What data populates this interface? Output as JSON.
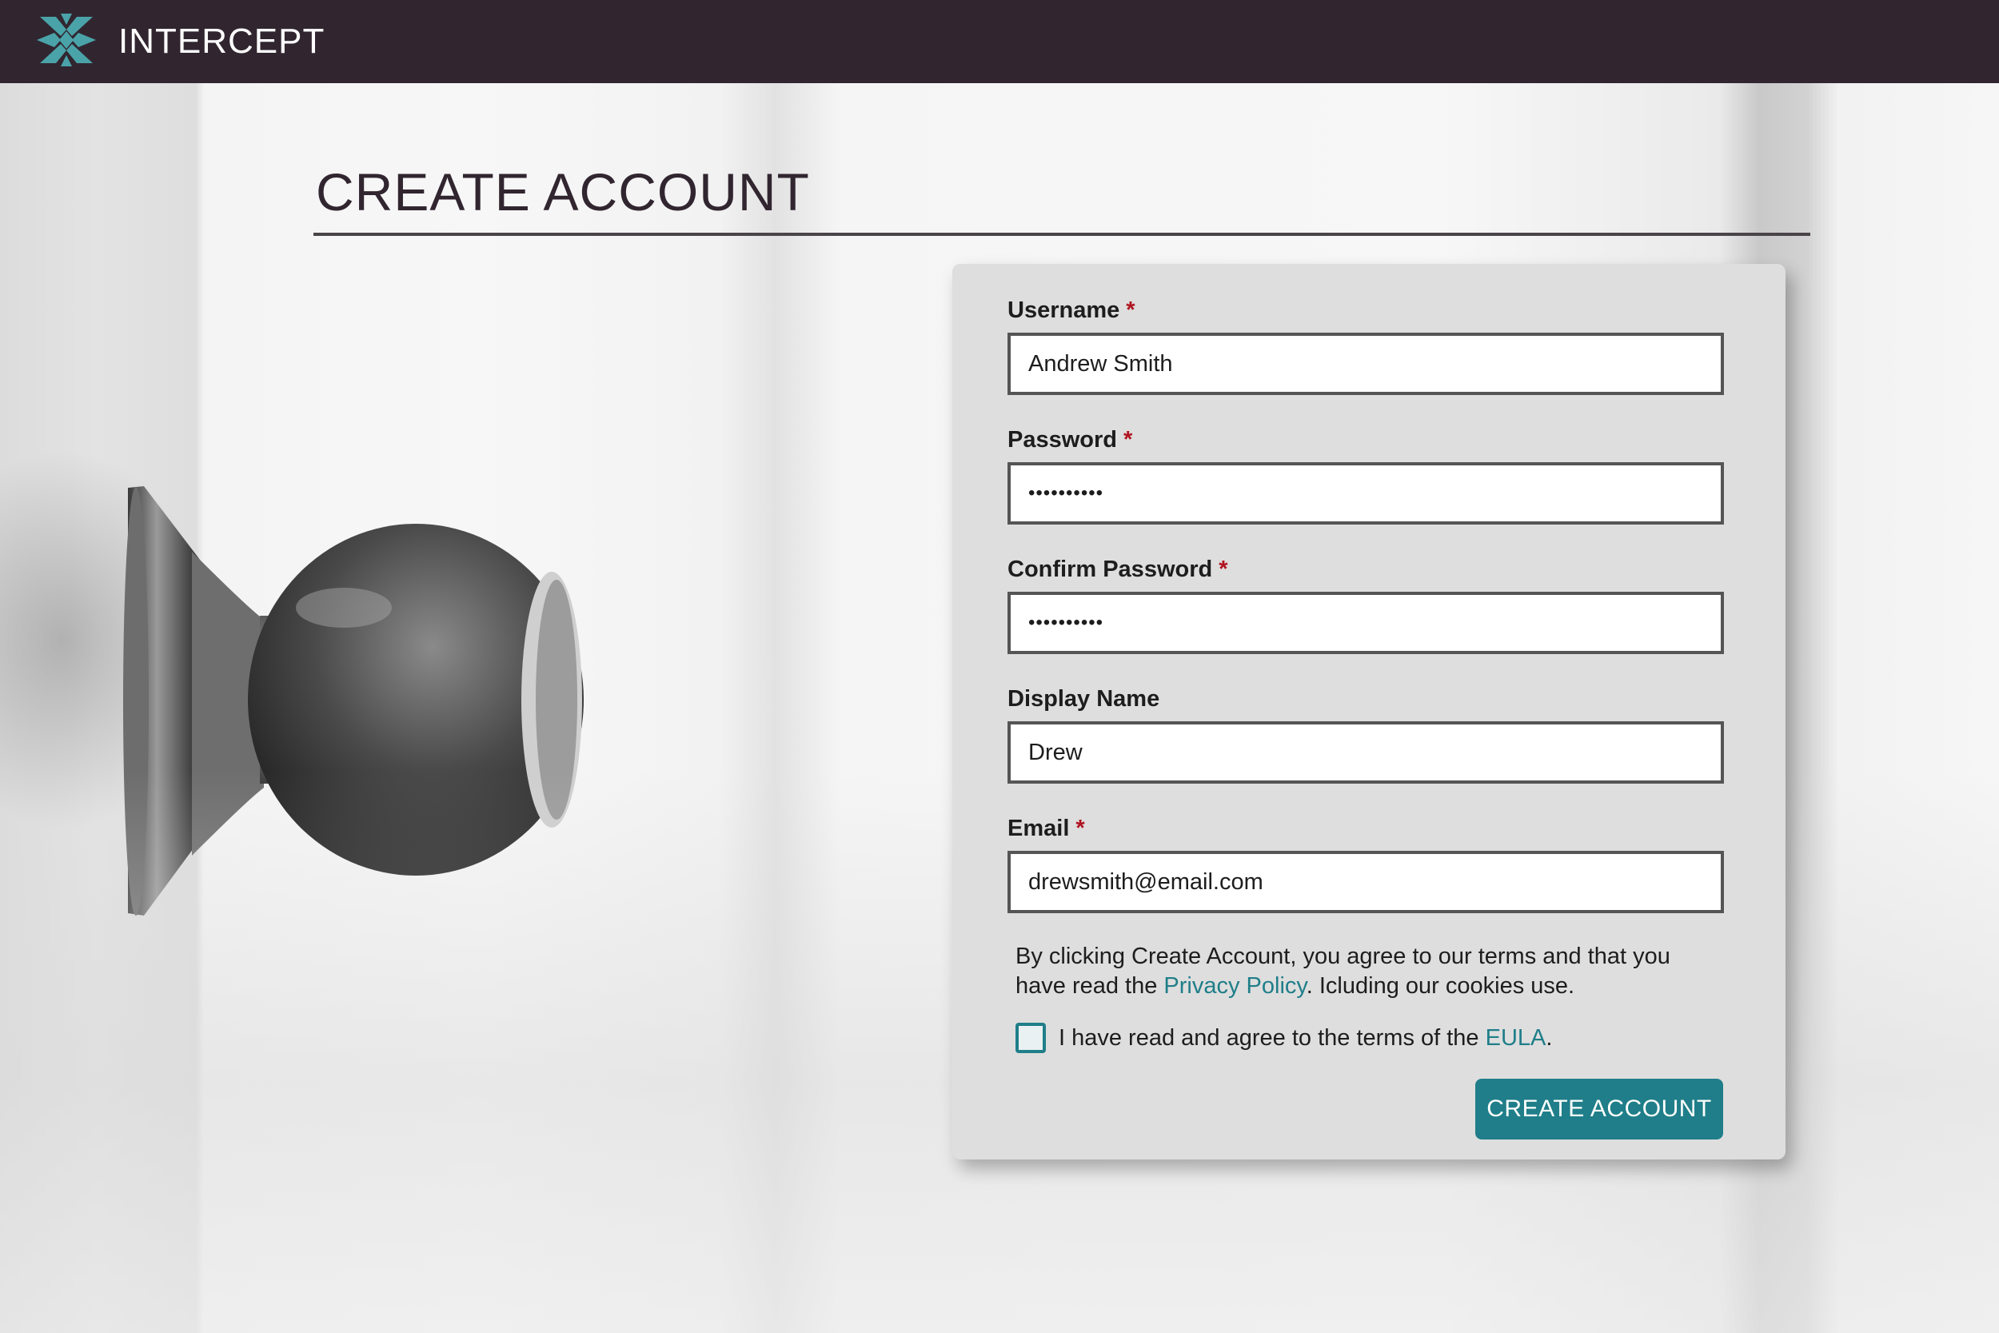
{
  "header": {
    "brand_name": "INTERCEPT",
    "logo_icon": "snowflake-x-logo-icon",
    "background_color": "#312630",
    "logo_color": "#4aa3a8"
  },
  "page": {
    "title": "CREATE ACCOUNT"
  },
  "form": {
    "fields": [
      {
        "label": "Username",
        "required": true,
        "value": "Andrew Smith",
        "type": "text"
      },
      {
        "label": "Password",
        "required": true,
        "value": "••••••••••",
        "type": "password"
      },
      {
        "label": "Confirm Password",
        "required": true,
        "value": "••••••••••",
        "type": "password"
      },
      {
        "label": "Display Name",
        "required": false,
        "value": "Drew",
        "type": "text"
      },
      {
        "label": "Email",
        "required": true,
        "value": "drewsmith@email.com",
        "type": "email"
      }
    ],
    "required_marker": "*",
    "terms_prefix": "By clicking Create Account, you agree to our terms and that you have read the ",
    "privacy_link": "Privacy Policy",
    "terms_suffix": ". Icluding our cookies use.",
    "eula_prefix": "I have read and agree to the terms of the ",
    "eula_link": "EULA",
    "eula_suffix": ".",
    "eula_checked": false,
    "submit_label": "CREATE ACCOUNT"
  },
  "colors": {
    "accent": "#1f7e89",
    "required": "#b0121f",
    "card": "#dedede"
  }
}
